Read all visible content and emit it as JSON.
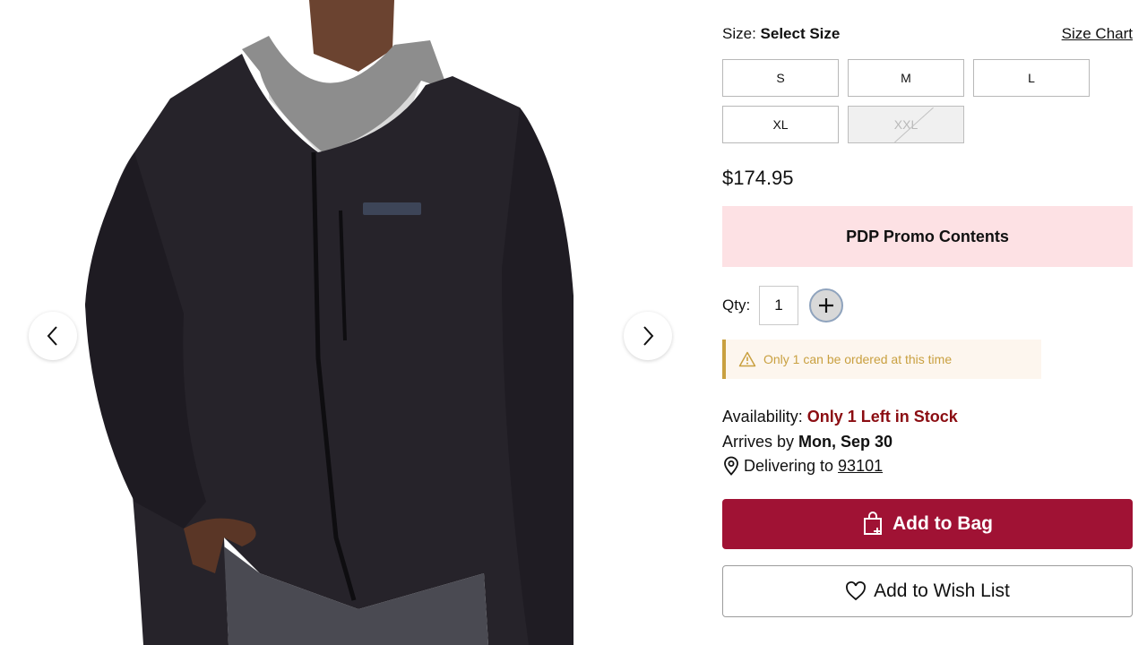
{
  "gallery": {
    "image_alt": "Marmot",
    "prev_icon": "chevron-left-icon",
    "next_icon": "chevron-right-icon"
  },
  "size": {
    "label": "Size:",
    "selected": "Select Size",
    "chart_link": "Size Chart",
    "options": [
      {
        "label": "S",
        "available": true
      },
      {
        "label": "M",
        "available": true
      },
      {
        "label": "L",
        "available": true
      },
      {
        "label": "XL",
        "available": true
      },
      {
        "label": "XXL",
        "available": false
      }
    ]
  },
  "price": "$174.95",
  "promo": "PDP Promo Contents",
  "quantity": {
    "label": "Qty:",
    "value": "1",
    "plus_icon": "plus-icon"
  },
  "alert": {
    "icon": "warning-icon",
    "text": "Only 1 can be ordered at this time"
  },
  "availability": {
    "label": "Availability:",
    "status": "Only 1 Left in Stock"
  },
  "arrival": {
    "label": "Arrives by",
    "date": "Mon, Sep 30"
  },
  "delivery": {
    "icon": "location-pin-icon",
    "label": "Delivering to",
    "zip": "93101"
  },
  "actions": {
    "add_to_bag": "Add to Bag",
    "add_to_wish_list": "Add to Wish List"
  },
  "colors": {
    "add_to_bag_bg": "#a01234",
    "promo_bg": "#fde1e4",
    "stock_text": "#8b0d12",
    "alert_accent": "#c9a040"
  }
}
